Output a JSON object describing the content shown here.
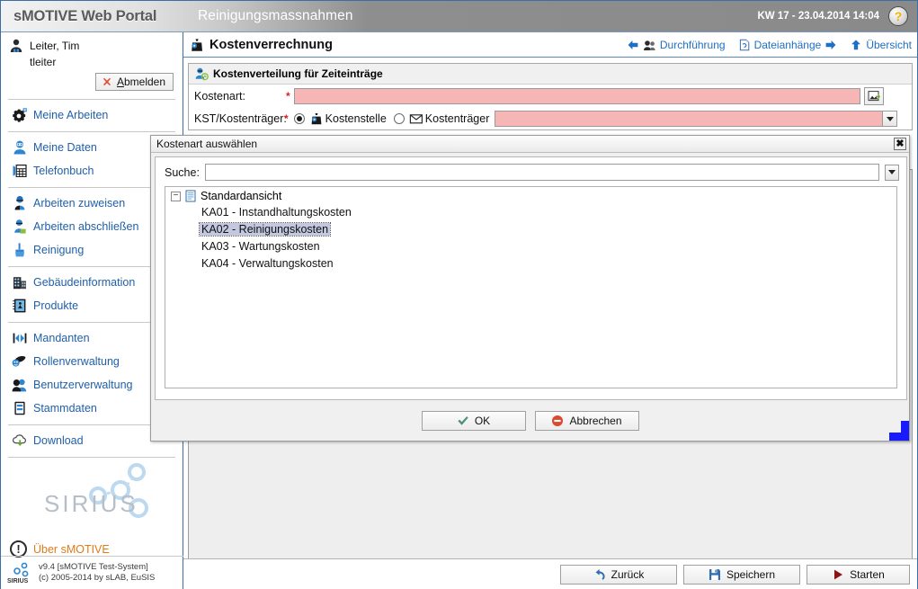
{
  "header": {
    "brand": "sMOTIVE Web Portal",
    "app_title": "Reinigungsmassnahmen",
    "kw_date": "KW 17 - 23.04.2014 14:04",
    "help_glyph": "?"
  },
  "sidebar": {
    "user": {
      "display_name": "Leiter, Tim",
      "login": "tleiter",
      "logout_prefix": "A",
      "logout_rest": "bmelden"
    },
    "groups": [
      {
        "items": [
          {
            "label": "Meine Arbeiten",
            "icon": "gear-icon"
          }
        ]
      },
      {
        "items": [
          {
            "label": "Meine Daten",
            "icon": "user-data-icon"
          },
          {
            "label": "Telefonbuch",
            "icon": "phonebook-icon"
          }
        ]
      },
      {
        "items": [
          {
            "label": "Arbeiten zuweisen",
            "icon": "assign-work-icon"
          },
          {
            "label": "Arbeiten abschließen",
            "icon": "complete-work-icon"
          },
          {
            "label": "Reinigung",
            "icon": "cleaning-icon"
          }
        ]
      },
      {
        "items": [
          {
            "label": "Gebäudeinformation",
            "icon": "building-icon"
          },
          {
            "label": "Produkte",
            "icon": "products-icon"
          }
        ]
      },
      {
        "items": [
          {
            "label": "Mandanten",
            "icon": "clients-icon"
          },
          {
            "label": "Rollenverwaltung",
            "icon": "roles-icon"
          },
          {
            "label": "Benutzerverwaltung",
            "icon": "users-icon"
          },
          {
            "label": "Stammdaten",
            "icon": "masterdata-icon"
          }
        ]
      },
      {
        "items": [
          {
            "label": "Download",
            "icon": "download-icon"
          }
        ]
      }
    ],
    "logo_text": "SIRIUS",
    "about_label": "Über sMOTIVE",
    "about_glyph": "!",
    "footer_line1": "v9.4 [sMOTIVE Test-System]",
    "footer_line2": "(c) 2005-2014 by sLAB, EuSIS"
  },
  "content": {
    "page_title": "Kostenverrechnung",
    "head_links": [
      {
        "label": "Durchführung",
        "icon": "back-arrow-icon",
        "position": "left"
      },
      {
        "label": "Dateianhänge",
        "icon": "attachment-icon",
        "position": "right"
      },
      {
        "label": "Übersicht",
        "icon": "up-arrow-icon",
        "position": "up"
      }
    ],
    "panel_title": "Kostenverteilung für Zeiteinträge",
    "fields": {
      "kostenart_label": "Kostenart:",
      "kostenart_value": "",
      "required_marker": "*",
      "kst_label": "KST/Kostenträger:",
      "radio_kostenstelle": "Kostenstelle",
      "radio_kostentraeger": "Kostenträger",
      "kst_value": ""
    },
    "buttons": [
      {
        "label": "Zurück",
        "icon": "undo-icon"
      },
      {
        "label": "Speichern",
        "icon": "save-icon"
      },
      {
        "label": "Starten",
        "icon": "play-icon"
      }
    ]
  },
  "modal": {
    "title": "Kostenart auswählen",
    "close_glyph": "✖",
    "search_label": "Suche:",
    "search_value": "",
    "search_placeholder": "",
    "tree": {
      "expander_glyph": "−",
      "root_label": "Standardansicht",
      "items": [
        {
          "label": "KA01 - Instandhaltungskosten",
          "selected": false
        },
        {
          "label": "KA02 - Reinigungskosten",
          "selected": true
        },
        {
          "label": "KA03 - Wartungskosten",
          "selected": false
        },
        {
          "label": "KA04 - Verwaltungskosten",
          "selected": false
        }
      ]
    },
    "ok_label": "OK",
    "cancel_label": "Abbrechen"
  },
  "colors": {
    "link_blue": "#1f5fa8",
    "required_pink": "#f7b6b6",
    "accent_orange": "#e07b1a",
    "selection": "#c3c8e0"
  }
}
